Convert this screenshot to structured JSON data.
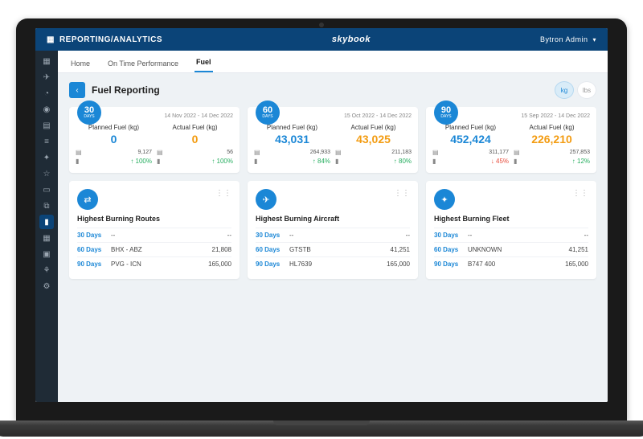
{
  "topbar": {
    "title": "REPORTING/ANALYTICS",
    "brand": "skybook",
    "user": "Bytron Admin"
  },
  "tabs": {
    "home": "Home",
    "otp": "On Time Performance",
    "fuel": "Fuel"
  },
  "page": {
    "title": "Fuel Reporting",
    "unit_kg": "kg",
    "unit_lbs": "lbs"
  },
  "summary": [
    {
      "days": "30",
      "days_label": "DAYS",
      "range": "14 Nov 2022 - 14 Dec 2022",
      "planned_label": "Planned Fuel (kg)",
      "actual_label": "Actual Fuel (kg)",
      "planned": "0",
      "actual": "0",
      "planned_sub": "9,127",
      "actual_sub": "56",
      "planned_pct": "↑ 100%",
      "actual_pct": "↑ 100%",
      "planned_pct_class": "up",
      "actual_pct_class": "up",
      "planned_color": "blue",
      "actual_color": "orange"
    },
    {
      "days": "60",
      "days_label": "DAYS",
      "range": "15 Oct 2022 - 14 Dec 2022",
      "planned_label": "Planned Fuel (kg)",
      "actual_label": "Actual Fuel (kg)",
      "planned": "43,031",
      "actual": "43,025",
      "planned_sub": "264,933",
      "actual_sub": "211,183",
      "planned_pct": "↑ 84%",
      "actual_pct": "↑ 80%",
      "planned_pct_class": "up",
      "actual_pct_class": "up",
      "planned_color": "blue",
      "actual_color": "orange"
    },
    {
      "days": "90",
      "days_label": "DAYS",
      "range": "15 Sep 2022 - 14 Dec 2022",
      "planned_label": "Planned Fuel (kg)",
      "actual_label": "Actual Fuel (kg)",
      "planned": "452,424",
      "actual": "226,210",
      "planned_sub": "311,177",
      "actual_sub": "257,853",
      "planned_pct": "↓ 45%",
      "actual_pct": "↑ 12%",
      "planned_pct_class": "down",
      "actual_pct_class": "up",
      "planned_color": "blue",
      "actual_color": "orange"
    }
  ],
  "sections": [
    {
      "icon": "⇄",
      "title": "Highest Burning Routes",
      "rows": [
        {
          "days": "30 Days",
          "name": "--",
          "val": "--"
        },
        {
          "days": "60 Days",
          "name": "BHX - ABZ",
          "val": "21,808"
        },
        {
          "days": "90 Days",
          "name": "PVG - ICN",
          "val": "165,000"
        }
      ]
    },
    {
      "icon": "✈",
      "title": "Highest Burning Aircraft",
      "rows": [
        {
          "days": "30 Days",
          "name": "--",
          "val": "--"
        },
        {
          "days": "60 Days",
          "name": "GTSTB",
          "val": "41,251"
        },
        {
          "days": "90 Days",
          "name": "HL7639",
          "val": "165,000"
        }
      ]
    },
    {
      "icon": "✦",
      "title": "Highest Burning Fleet",
      "rows": [
        {
          "days": "30 Days",
          "name": "--",
          "val": "--"
        },
        {
          "days": "60 Days",
          "name": "UNKNOWN",
          "val": "41,251"
        },
        {
          "days": "90 Days",
          "name": "B747 400",
          "val": "165,000"
        }
      ]
    }
  ]
}
